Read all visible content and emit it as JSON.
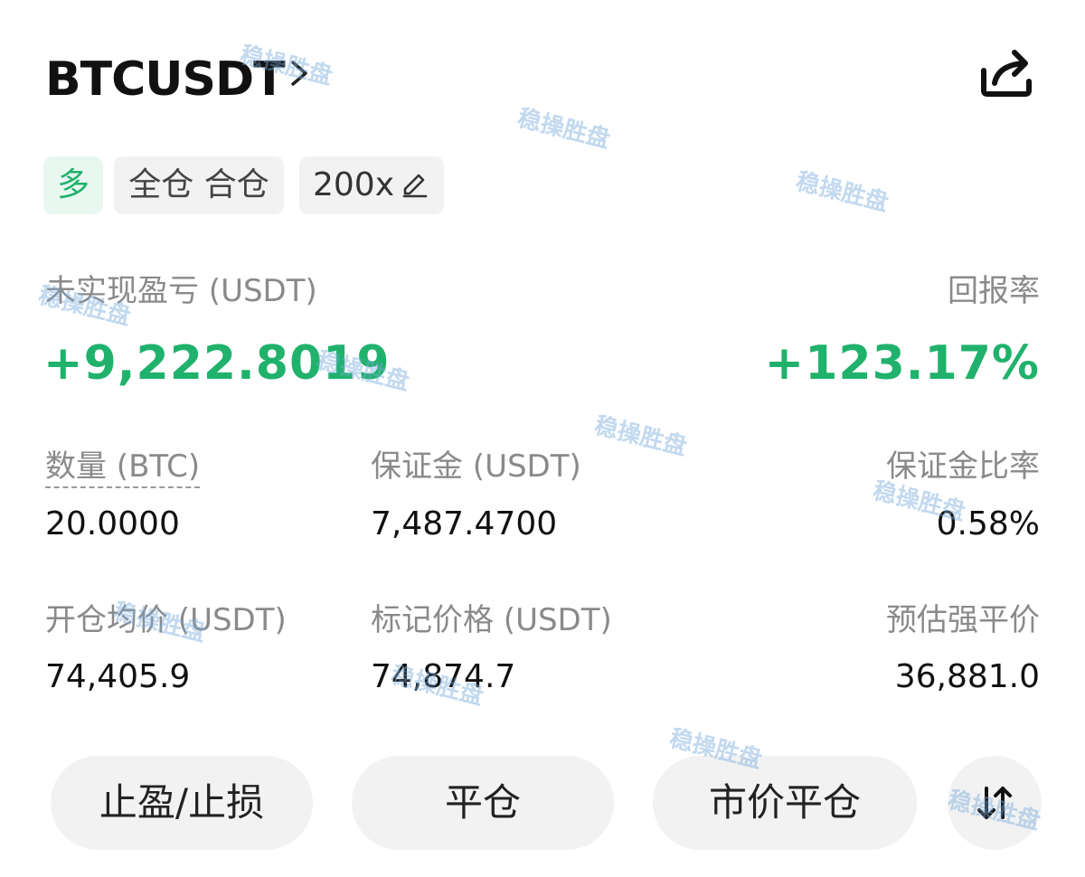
{
  "header": {
    "symbol": "BTCUSDT",
    "chevron_icon": "chevron-right-icon",
    "share_icon": "share-icon"
  },
  "tags": {
    "side": "多",
    "margin_mode": "全仓 合仓",
    "leverage": "200x",
    "edit_icon": "edit-pencil-icon"
  },
  "pnl": {
    "unrealized_label": "未实现盈亏 (USDT)",
    "unrealized_value": "+9,222.8019",
    "roe_label": "回报率",
    "roe_value": "+123.17%"
  },
  "stats": {
    "qty_label": "数量 (BTC)",
    "qty_value": "20.0000",
    "margin_label": "保证金 (USDT)",
    "margin_value": "7,487.4700",
    "margin_ratio_label": "保证金比率",
    "margin_ratio_value": "0.58%",
    "entry_label": "开仓均价 (USDT)",
    "entry_value": "74,405.9",
    "mark_label": "标记价格 (USDT)",
    "mark_value": "74,874.7",
    "liq_label": "预估强平价",
    "liq_value": "36,881.0"
  },
  "actions": {
    "tpsl": "止盈/止损",
    "close": "平仓",
    "market_close": "市价平仓",
    "reverse_icon": "swap-arrows-icon"
  },
  "watermark": "稳操胜盘",
  "colors": {
    "profit_green": "#20b26c",
    "long_tag_bg": "#e8f7ef",
    "button_bg": "#f2f2f2",
    "label_gray": "#8a8a8a"
  }
}
